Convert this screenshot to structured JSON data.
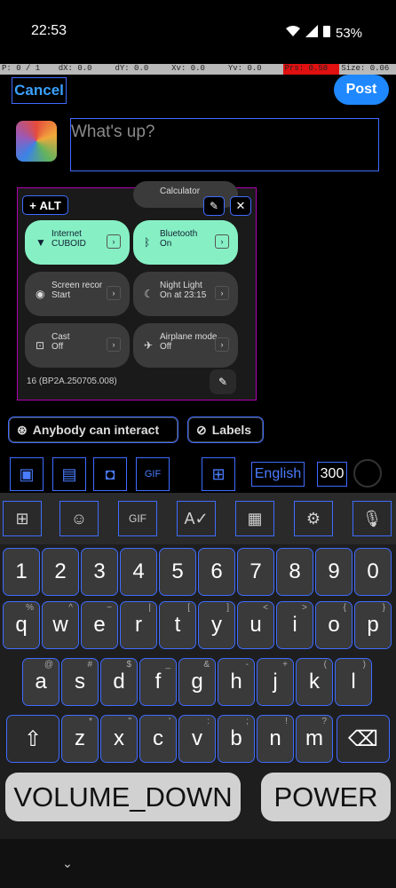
{
  "status": {
    "time": "22:53",
    "battery": "53%",
    "icons": [
      "wifi-icon",
      "signal-icon",
      "battery-icon"
    ]
  },
  "pointer": {
    "p": "P: 0 / 1",
    "dx": "dX: 0.0",
    "dy": "dY: 0.0",
    "xv": "Xv: 0.0",
    "yv": "Yv: 0.0",
    "prs": "Prs: 0.58",
    "size": "Size: 0.06"
  },
  "header": {
    "cancel": "Cancel",
    "post": "Post"
  },
  "composer": {
    "placeholder": "What's up?"
  },
  "preview": {
    "alt": "ALT",
    "calc": "Calculator",
    "tiles": [
      {
        "title": "Internet",
        "sub": "CUBOID"
      },
      {
        "title": "Bluetooth",
        "sub": "On"
      },
      {
        "title": "Screen recor",
        "sub": "Start"
      },
      {
        "title": "Night Light",
        "sub": "On at 23:15"
      },
      {
        "title": "Cast",
        "sub": "Off"
      },
      {
        "title": "Airplane mode",
        "sub": "Off"
      }
    ],
    "build": "16 (BP2A.250705.008)"
  },
  "chips": {
    "interact": "Anybody can interact",
    "labels": "Labels"
  },
  "toolbar": {
    "lang": "English",
    "count": "300"
  },
  "keyboard": {
    "numbers": [
      "1",
      "2",
      "3",
      "4",
      "5",
      "6",
      "7",
      "8",
      "9",
      "0"
    ],
    "row1": [
      "q",
      "w",
      "e",
      "r",
      "t",
      "y",
      "u",
      "i",
      "o",
      "p"
    ],
    "row1_alt": [
      "%",
      "^",
      "~",
      "|",
      "[",
      "]",
      "<",
      ">",
      "{",
      "}"
    ],
    "row2": [
      "a",
      "s",
      "d",
      "f",
      "g",
      "h",
      "j",
      "k",
      "l"
    ],
    "row2_alt": [
      "@",
      "#",
      "$",
      "_",
      "&",
      "-",
      "+",
      "(",
      ")"
    ],
    "row3": [
      "z",
      "x",
      "c",
      "v",
      "b",
      "n",
      "m"
    ],
    "row3_alt": [
      "*",
      "\"",
      "'",
      ":",
      ";",
      "!",
      "?"
    ]
  },
  "overlay": {
    "vol": "VOLUME_DOWN",
    "power": "POWER"
  }
}
